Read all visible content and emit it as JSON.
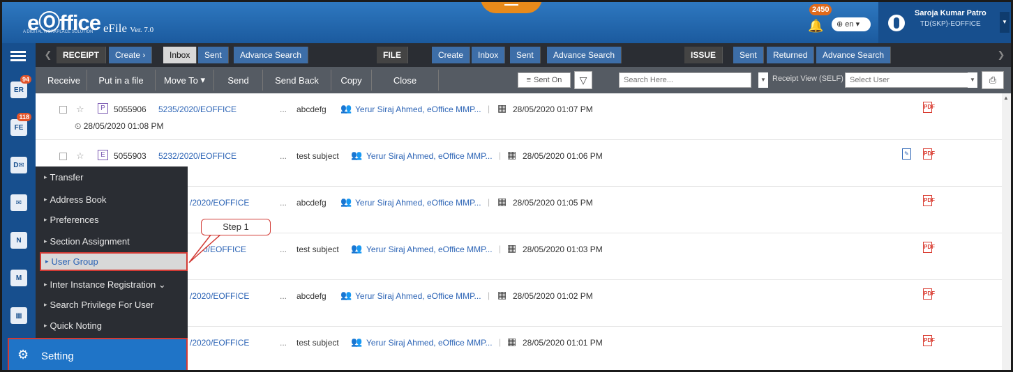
{
  "header": {
    "logo": "eⓄffice",
    "logo_sub": "A DIGITAL WORKPLACE SOLUTION",
    "product": "eFile",
    "version": "Ver. 7.0",
    "notification_count": "2450",
    "language": "en",
    "user_name": "Saroja Kumar Patro",
    "user_designation": "TD(SKP)-EOFFICE"
  },
  "leftnav": {
    "badges": [
      "94",
      "118"
    ]
  },
  "menubar": {
    "receipt": {
      "label": "RECEIPT",
      "create": "Create",
      "inbox": "Inbox",
      "sent": "Sent",
      "advance": "Advance Search"
    },
    "file": {
      "label": "FILE",
      "create": "Create",
      "inbox": "Inbox",
      "sent": "Sent",
      "advance": "Advance Search"
    },
    "issue": {
      "label": "ISSUE",
      "sent": "Sent",
      "returned": "Returned",
      "advance": "Advance Search"
    }
  },
  "toolbar": {
    "receive": "Receive",
    "put_in_file": "Put in a file",
    "move_to": "Move To",
    "send": "Send",
    "send_back": "Send Back",
    "copy": "Copy",
    "close": "Close",
    "sent_on": "Sent On",
    "search_placeholder": "Search Here...",
    "receipt_view": "Receipt View (SELF)",
    "select_user_placeholder": "Select User"
  },
  "rows": [
    {
      "tag": "P",
      "receipt_no": "5055906",
      "file_no": "5235/2020/EOFFICE",
      "dots": "...",
      "subject": "abcdefg",
      "sender": "Yerur Siraj Ahmed, eOffice MMP...",
      "date": "28/05/2020 01:07 PM",
      "sub_date": "28/05/2020 01:08 PM"
    },
    {
      "tag": "E",
      "receipt_no": "5055903",
      "file_no": "5232/2020/EOFFICE",
      "dots": "...",
      "subject": "test subject",
      "sender": "Yerur Siraj Ahmed, eOffice MMP...",
      "date": "28/05/2020 01:06 PM"
    },
    {
      "file_no": "/2020/EOFFICE",
      "dots": "...",
      "subject": "abcdefg",
      "sender": "Yerur Siraj Ahmed, eOffice MMP...",
      "date": "28/05/2020 01:05 PM"
    },
    {
      "file_no": "0/EOFFICE",
      "dots": "...",
      "subject": "test subject",
      "sender": "Yerur Siraj Ahmed, eOffice MMP...",
      "date": "28/05/2020 01:03 PM"
    },
    {
      "file_no": "/2020/EOFFICE",
      "dots": "...",
      "subject": "abcdefg",
      "sender": "Yerur Siraj Ahmed, eOffice MMP...",
      "date": "28/05/2020 01:02 PM"
    },
    {
      "file_no": "/2020/EOFFICE",
      "dots": "...",
      "subject": "test subject",
      "sender": "Yerur Siraj Ahmed, eOffice MMP...",
      "date": "28/05/2020 01:01 PM"
    }
  ],
  "flyout": {
    "items": [
      "Transfer",
      "Address Book",
      "Preferences",
      "Section Assignment",
      "User Group",
      "Inter Instance Registration ⌄",
      "Search Privilege For User",
      "Quick Noting"
    ],
    "setting": "Setting"
  },
  "callout": "Step 1",
  "colors": {
    "header": "#1f64a8",
    "nav": "#174f8e",
    "menubar": "#2a2d33",
    "highlight": "#d23a34",
    "link": "#2b63b5",
    "setting": "#1f74c7"
  }
}
